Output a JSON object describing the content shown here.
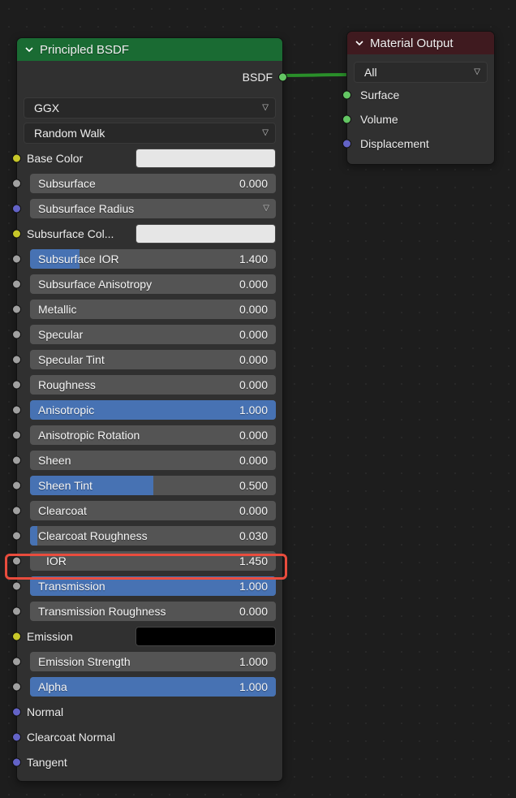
{
  "principled": {
    "title": "Principled BSDF",
    "output_label": "BSDF",
    "distribution": "GGX",
    "subsurface_method": "Random Walk",
    "subsurface_radius_label": "Subsurface Radius",
    "params": {
      "base_color": {
        "label": "Base Color"
      },
      "subsurface": {
        "label": "Subsurface",
        "value": "0.000",
        "fill": 0
      },
      "subsurface_col": {
        "label": "Subsurface Col..."
      },
      "subsurface_ior": {
        "label": "Subsurface IOR",
        "value": "1.400",
        "fill": 0.2
      },
      "subsurface_aniso": {
        "label": "Subsurface Anisotropy",
        "value": "0.000",
        "fill": 0
      },
      "metallic": {
        "label": "Metallic",
        "value": "0.000",
        "fill": 0
      },
      "specular": {
        "label": "Specular",
        "value": "0.000",
        "fill": 0
      },
      "specular_tint": {
        "label": "Specular Tint",
        "value": "0.000",
        "fill": 0
      },
      "roughness": {
        "label": "Roughness",
        "value": "0.000",
        "fill": 0
      },
      "anisotropic": {
        "label": "Anisotropic",
        "value": "1.000",
        "fill": 1.0
      },
      "anisotropic_rot": {
        "label": "Anisotropic Rotation",
        "value": "0.000",
        "fill": 0
      },
      "sheen": {
        "label": "Sheen",
        "value": "0.000",
        "fill": 0
      },
      "sheen_tint": {
        "label": "Sheen Tint",
        "value": "0.500",
        "fill": 0.5
      },
      "clearcoat": {
        "label": "Clearcoat",
        "value": "0.000",
        "fill": 0
      },
      "clearcoat_roughness": {
        "label": "Clearcoat Roughness",
        "value": "0.030",
        "fill": 0.03
      },
      "ior": {
        "label": "IOR",
        "value": "1.450",
        "fill": 0
      },
      "transmission": {
        "label": "Transmission",
        "value": "1.000",
        "fill": 1.0
      },
      "transmission_roughness": {
        "label": "Transmission Roughness",
        "value": "0.000",
        "fill": 0
      },
      "emission": {
        "label": "Emission"
      },
      "emission_strength": {
        "label": "Emission Strength",
        "value": "1.000",
        "fill": 0
      },
      "alpha": {
        "label": "Alpha",
        "value": "1.000",
        "fill": 1.0
      },
      "normal": {
        "label": "Normal"
      },
      "clearcoat_normal": {
        "label": "Clearcoat Normal"
      },
      "tangent": {
        "label": "Tangent"
      }
    }
  },
  "material_output": {
    "title": "Material Output",
    "target": "All",
    "inputs": {
      "surface": "Surface",
      "volume": "Volume",
      "displacement": "Displacement"
    }
  }
}
